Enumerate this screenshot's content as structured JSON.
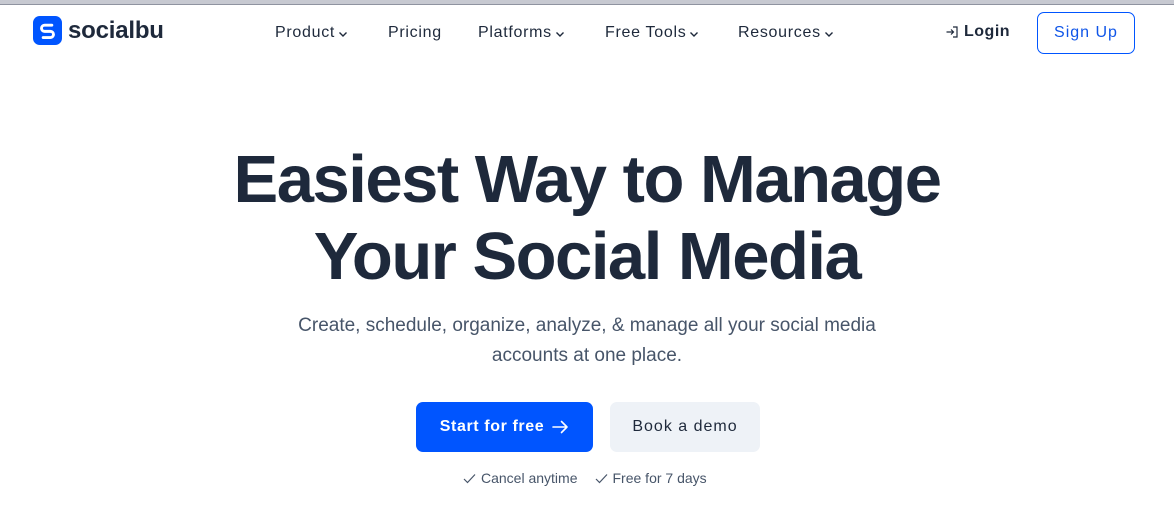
{
  "brand": {
    "name": "socialbu",
    "accent": "#0055ff",
    "text_color": "#1e293b"
  },
  "nav": {
    "items": [
      {
        "label": "Product",
        "icon": "chevron-down-icon"
      },
      {
        "label": "Pricing"
      },
      {
        "label": "Platforms",
        "icon": "chevron-down-icon"
      },
      {
        "label": "Free Tools",
        "icon": "chevron-down-icon"
      },
      {
        "label": "Resources",
        "icon": "chevron-down-icon"
      }
    ],
    "login_label": "Login",
    "login_icon": "login-icon",
    "signup_label": "Sign Up"
  },
  "hero": {
    "title_line1": "Easiest Way to Manage",
    "title_line2": "Your Social Media",
    "subtitle_line1": "Create, schedule, organize, analyze, & manage all your social media",
    "subtitle_line2": "accounts at one place.",
    "primary_cta": "Start for free",
    "primary_cta_icon": "arrow-right-icon",
    "secondary_cta": "Book a demo",
    "perks": [
      {
        "label": "Cancel anytime",
        "icon": "check-icon"
      },
      {
        "label": "Free for 7 days",
        "icon": "check-icon"
      }
    ]
  }
}
